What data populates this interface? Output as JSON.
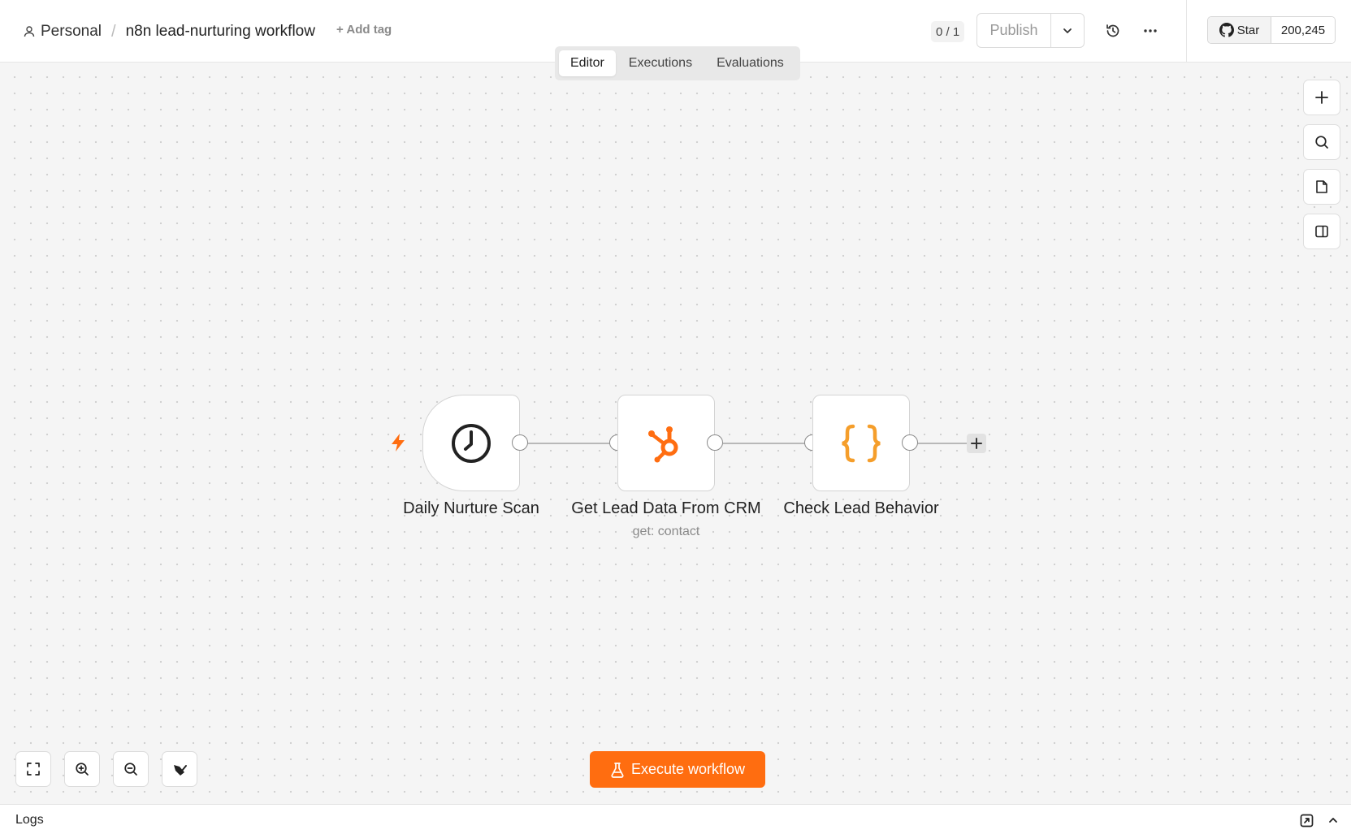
{
  "header": {
    "breadcrumb_project": "Personal",
    "breadcrumb_separator": "/",
    "workflow_name": "n8n lead-nurturing workflow",
    "add_tag": "+ Add tag",
    "version_counter": "0 / 1",
    "publish_label": "Publish",
    "github_star_label": "Star",
    "github_star_count": "200,245"
  },
  "tabs": [
    {
      "label": "Editor",
      "active": true
    },
    {
      "label": "Executions",
      "active": false
    },
    {
      "label": "Evaluations",
      "active": false
    }
  ],
  "nodes": [
    {
      "label": "Daily Nurture Scan",
      "subtitle": "",
      "icon": "clock-icon"
    },
    {
      "label": "Get Lead Data From CRM",
      "subtitle": "get: contact",
      "icon": "hubspot-icon"
    },
    {
      "label": "Check Lead Behavior",
      "subtitle": "",
      "icon": "code-braces-icon"
    }
  ],
  "canvas_controls": {
    "execute_label": "Execute workflow"
  },
  "logs": {
    "label": "Logs"
  },
  "colors": {
    "accent": "#ff6d10",
    "canvas_bg": "#f5f5f5"
  }
}
